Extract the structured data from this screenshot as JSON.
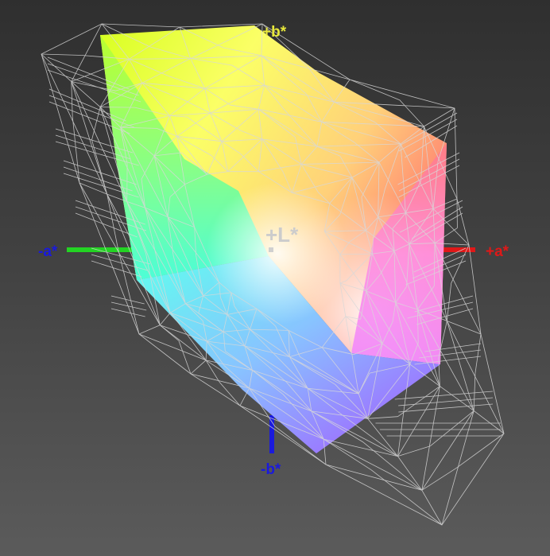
{
  "axes": {
    "pos_b": {
      "label": "+b*",
      "color": "#e8e83a"
    },
    "neg_b": {
      "label": "-b*",
      "color": "#1a1adc"
    },
    "neg_a": {
      "label": "-a*",
      "color": "#1a1adc",
      "line_color": "#23d323"
    },
    "pos_a": {
      "label": "+a*",
      "color": "#e01818",
      "line_color": "#e01818"
    },
    "l": {
      "label": "+L*",
      "color": "#cccccc"
    }
  },
  "colors": {
    "background_top": "#2f2f2f",
    "background_bottom": "#5b5b5b",
    "wireframe": "#d8d8d8"
  }
}
